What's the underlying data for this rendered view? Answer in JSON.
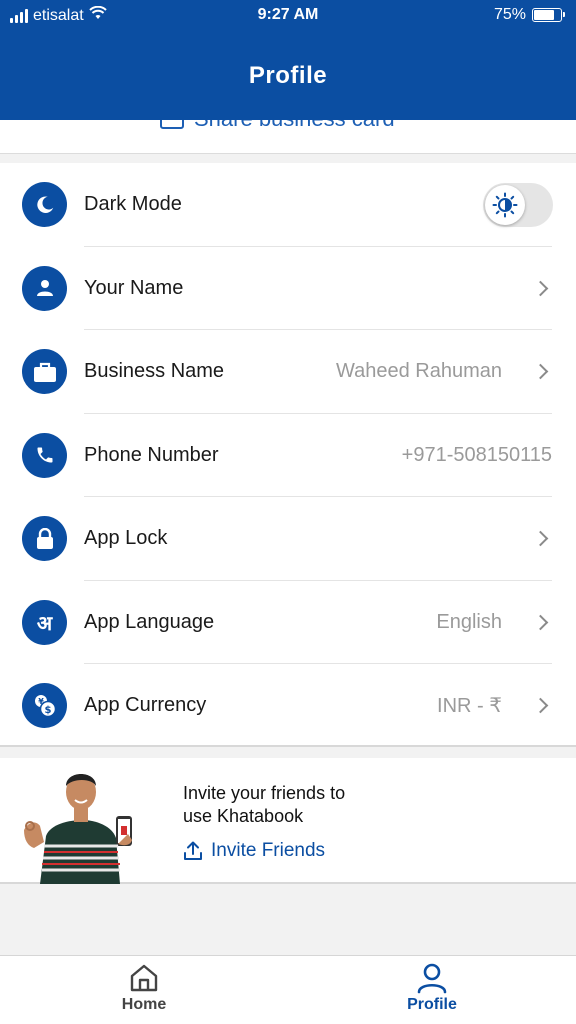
{
  "status_bar": {
    "carrier": "etisalat",
    "time": "9:27 AM",
    "battery": "75%",
    "battery_level": 0.75
  },
  "header": {
    "title": "Profile"
  },
  "share_card": {
    "label": "Share business card",
    "icon": "card-icon"
  },
  "settings": {
    "dark_mode": {
      "label": "Dark Mode",
      "icon": "moon-icon",
      "toggle_on": false,
      "toggle_icon": "sun-icon"
    },
    "your_name": {
      "label": "Your Name",
      "icon": "person-icon",
      "value": ""
    },
    "business_name": {
      "label": "Business Name",
      "icon": "briefcase-icon",
      "value": "Waheed Rahuman"
    },
    "phone_number": {
      "label": "Phone Number",
      "icon": "phone-icon",
      "value": "+971-508150115"
    },
    "app_lock": {
      "label": "App Lock",
      "icon": "lock-icon"
    },
    "app_language": {
      "label": "App Language",
      "icon": "language-icon",
      "icon_glyph": "अ",
      "value": "English"
    },
    "app_currency": {
      "label": "App Currency",
      "icon": "currency-icon",
      "value": "INR - ₹"
    }
  },
  "invite": {
    "line1": "Invite your friends to",
    "line2": "use Khatabook",
    "link": "Invite Friends",
    "icon": "share-upload-icon"
  },
  "tabbar": {
    "home": {
      "label": "Home",
      "icon": "home-icon"
    },
    "profile": {
      "label": "Profile",
      "icon": "profile-icon",
      "active": true
    }
  },
  "colors": {
    "brand": "#0b4ea2",
    "link": "#1d5fb4",
    "muted": "#9a9a9a"
  }
}
